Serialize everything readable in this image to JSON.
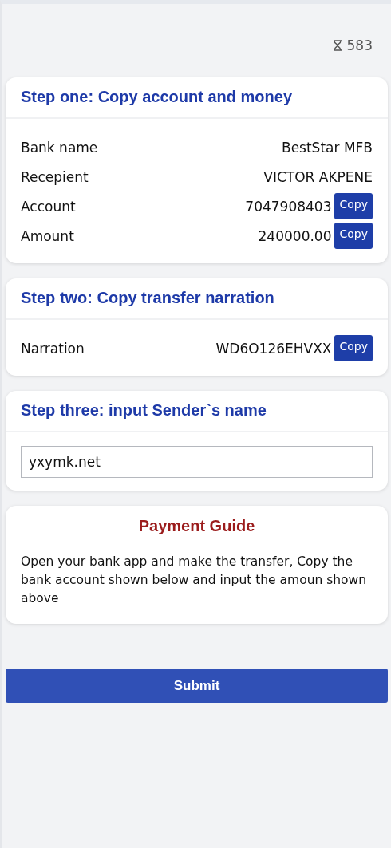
{
  "timer": {
    "value": "583"
  },
  "steps": [
    {
      "title": "Step one: Copy account and money",
      "kind": "rows",
      "rows": [
        {
          "label": "Bank name",
          "value": "BestStar MFB"
        },
        {
          "label": "Recepient",
          "value": "VICTOR AKPENE"
        },
        {
          "label": "Account",
          "value": "7047908403",
          "button": "Copy"
        },
        {
          "label": "Amount",
          "value": "240000.00",
          "button": "Copy"
        }
      ]
    },
    {
      "title": "Step two: Copy transfer narration",
      "kind": "rows",
      "rows": [
        {
          "label": "Narration",
          "value": "WD6O126EHVXX",
          "button": "Copy"
        }
      ]
    },
    {
      "title": "Step three: input Sender`s name",
      "kind": "input",
      "value": "yxymk.net"
    }
  ],
  "guide": {
    "title": "Payment Guide",
    "text": "Open your bank app and make the transfer, Copy the bank account shown below and input the amoun shown above"
  },
  "submit": "Submit"
}
